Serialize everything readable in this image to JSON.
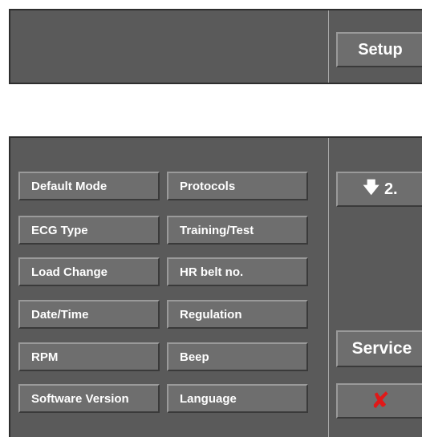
{
  "top": {
    "setup_label": "Setup"
  },
  "menu": {
    "left": [
      "Default Mode",
      "ECG Type",
      "Load Change",
      "Date/Time",
      "RPM",
      "Software Version"
    ],
    "right": [
      "Protocols",
      "Training/Test",
      "HR belt no.",
      "Regulation",
      "Beep",
      "Language"
    ]
  },
  "side": {
    "page_arrow": "🡇",
    "page_label": "2.",
    "service_label": "Service",
    "close_glyph": "✘"
  },
  "colors": {
    "panel": "#5a5a5a",
    "button": "#6e6e6e",
    "close_x": "#e01818"
  }
}
